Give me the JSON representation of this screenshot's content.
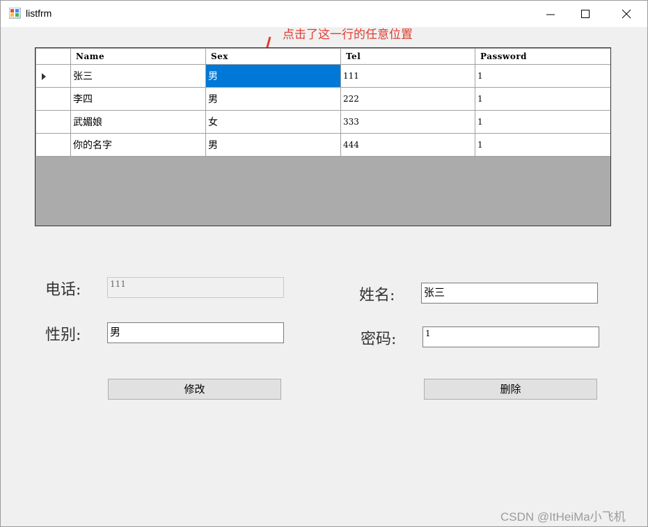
{
  "window": {
    "title": "listfrm"
  },
  "annotation": {
    "text": "点击了这一行的任意位置"
  },
  "grid": {
    "columns": [
      "Name",
      "Sex",
      "Tel",
      "Password"
    ],
    "rows": [
      {
        "name": "张三",
        "sex": "男",
        "tel": "111",
        "password": "1"
      },
      {
        "name": "李四",
        "sex": "男",
        "tel": "222",
        "password": "1"
      },
      {
        "name": "武媚娘",
        "sex": "女",
        "tel": "333",
        "password": "1"
      },
      {
        "name": "你的名字",
        "sex": "男",
        "tel": "444",
        "password": "1"
      }
    ]
  },
  "form": {
    "phone_label": "电话:",
    "phone_value": "111",
    "gender_label": "性别:",
    "gender_value": "男",
    "name_label": "姓名:",
    "name_value": "张三",
    "password_label": "密码:",
    "password_value": "1",
    "modify_button": "修改",
    "delete_button": "删除"
  },
  "watermark": "CSDN @ItHeiMa小飞机",
  "colors": {
    "selection": "#0078d7",
    "annotation": "#e03c31",
    "grid_bg": "#ababab"
  }
}
